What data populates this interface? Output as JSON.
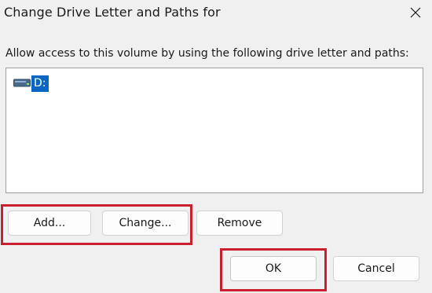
{
  "window": {
    "title": "Change Drive Letter and Paths for"
  },
  "icons": {
    "close": "close-icon",
    "drive": "drive-icon"
  },
  "dialog": {
    "instruction": "Allow access to this volume by using the following drive letter and paths:",
    "items": [
      {
        "label": "D:",
        "selected": true
      }
    ]
  },
  "buttons": {
    "add": "Add...",
    "change": "Change...",
    "remove": "Remove",
    "ok": "OK",
    "cancel": "Cancel"
  },
  "colors": {
    "selection": "#0a66c2",
    "highlight_annotation": "#cc1f2d",
    "background": "#f0f0f0"
  }
}
